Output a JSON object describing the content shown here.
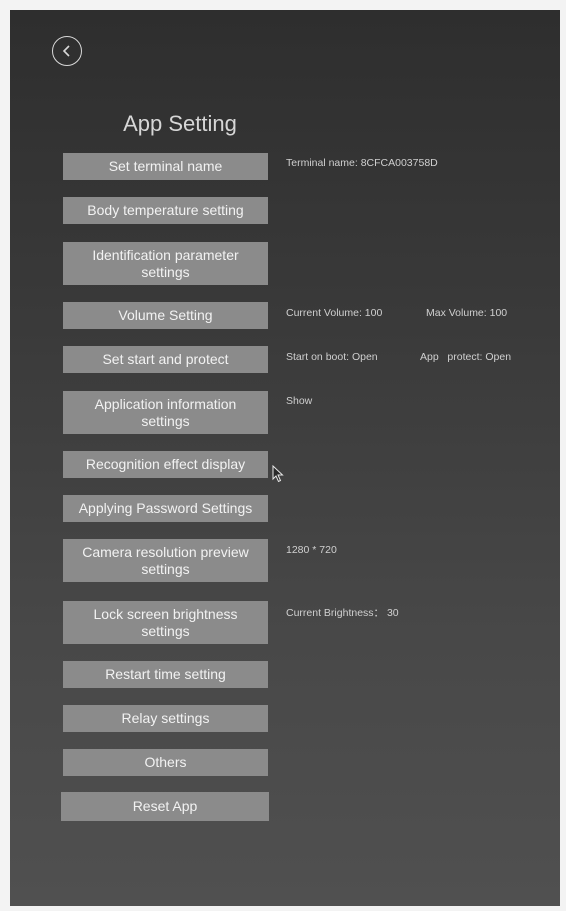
{
  "header": {
    "back_icon": "back-arrow-circle-icon",
    "title": "App Setting"
  },
  "menu": [
    {
      "label": "Set terminal name"
    },
    {
      "label": "Body temperature setting"
    },
    {
      "label": "Identification parameter settings"
    },
    {
      "label": "Volume Setting"
    },
    {
      "label": "Set start and protect"
    },
    {
      "label": "Application information settings"
    },
    {
      "label": "Recognition effect display"
    },
    {
      "label": "Applying Password Settings"
    },
    {
      "label": "Camera resolution preview settings"
    },
    {
      "label": "Lock screen brightness settings"
    },
    {
      "label": "Restart time setting"
    },
    {
      "label": "Relay settings"
    },
    {
      "label": "Others"
    },
    {
      "label": "Reset App"
    }
  ],
  "info": {
    "terminal_name": "Terminal name: 8CFCA003758D",
    "current_volume": "Current Volume: 100",
    "max_volume": "Max Volume: 100",
    "start_on_boot": "Start on boot: Open",
    "app_protect": "App   protect: Open",
    "app_info": "Show",
    "camera_resolution": "1280 * 720",
    "brightness": "Current Brightness： 30"
  },
  "colors": {
    "background_top": "#2e2e2e",
    "background_bottom": "#505050",
    "button": "#8b8b8b",
    "text": "#f2f2f2"
  }
}
